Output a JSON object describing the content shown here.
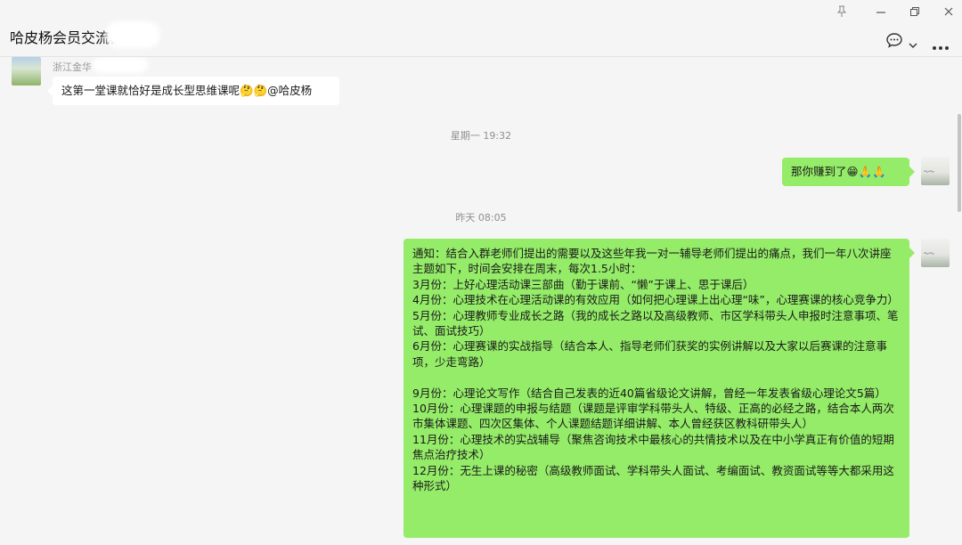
{
  "window": {
    "title": "哈皮杨会员交流群",
    "pin_icon": "pin-icon",
    "minimize_icon": "minimize-icon",
    "restore_icon": "restore-icon",
    "close_icon": "close-icon"
  },
  "header": {
    "chat_icon": "chat-bubble-icon",
    "chevron_icon": "chevron-down-icon",
    "more_icon": "more-icon"
  },
  "messages": {
    "m1": {
      "sender": "浙江金华",
      "text": "这第一堂课就恰好是成长型思维课呢🤔🤔@哈皮杨"
    },
    "t1": "星期一 19:32",
    "m2": {
      "text": "那你赚到了😁🙏🙏"
    },
    "t2": "昨天 08:05",
    "m3": {
      "lines": [
        "通知：结合入群老师们提出的需要以及这些年我一对一辅导老师们提出的痛点，我们一年八次讲座主题如下，时间会安排在周末，每次1.5小时：",
        "3月份：上好心理活动课三部曲（勤于课前、“懒”于课上、思于课后）",
        "4月份：心理技术在心理活动课的有效应用（如何把心理课上出心理“味”，心理赛课的核心竞争力）",
        "5月份：心理教师专业成长之路（我的成长之路以及高级教师、市区学科带头人申报时注意事项、笔试、面试技巧）",
        "6月份：心理赛课的实战指导（结合本人、指导老师们获奖的实例讲解以及大家以后赛课的注意事项，少走弯路）",
        "",
        "9月份：心理论文写作（结合自己发表的近40篇省级论文讲解，曾经一年发表省级心理论文5篇）",
        "10月份：心理课题的申报与结题（课题是评审学科带头人、特级、正高的必经之路，结合本人两次市集体课题、四次区集体、个人课题结题详细讲解、本人曾经获区教科研带头人）",
        "11月份：心理技术的实战辅导（聚焦咨询技术中最核心的共情技术以及在中小学真正有价值的短期焦点治疗技术）",
        "12月份：无生上课的秘密（高级教师面试、学科带头人面试、考编面试、教资面试等等大都采用这种形式）"
      ]
    }
  }
}
